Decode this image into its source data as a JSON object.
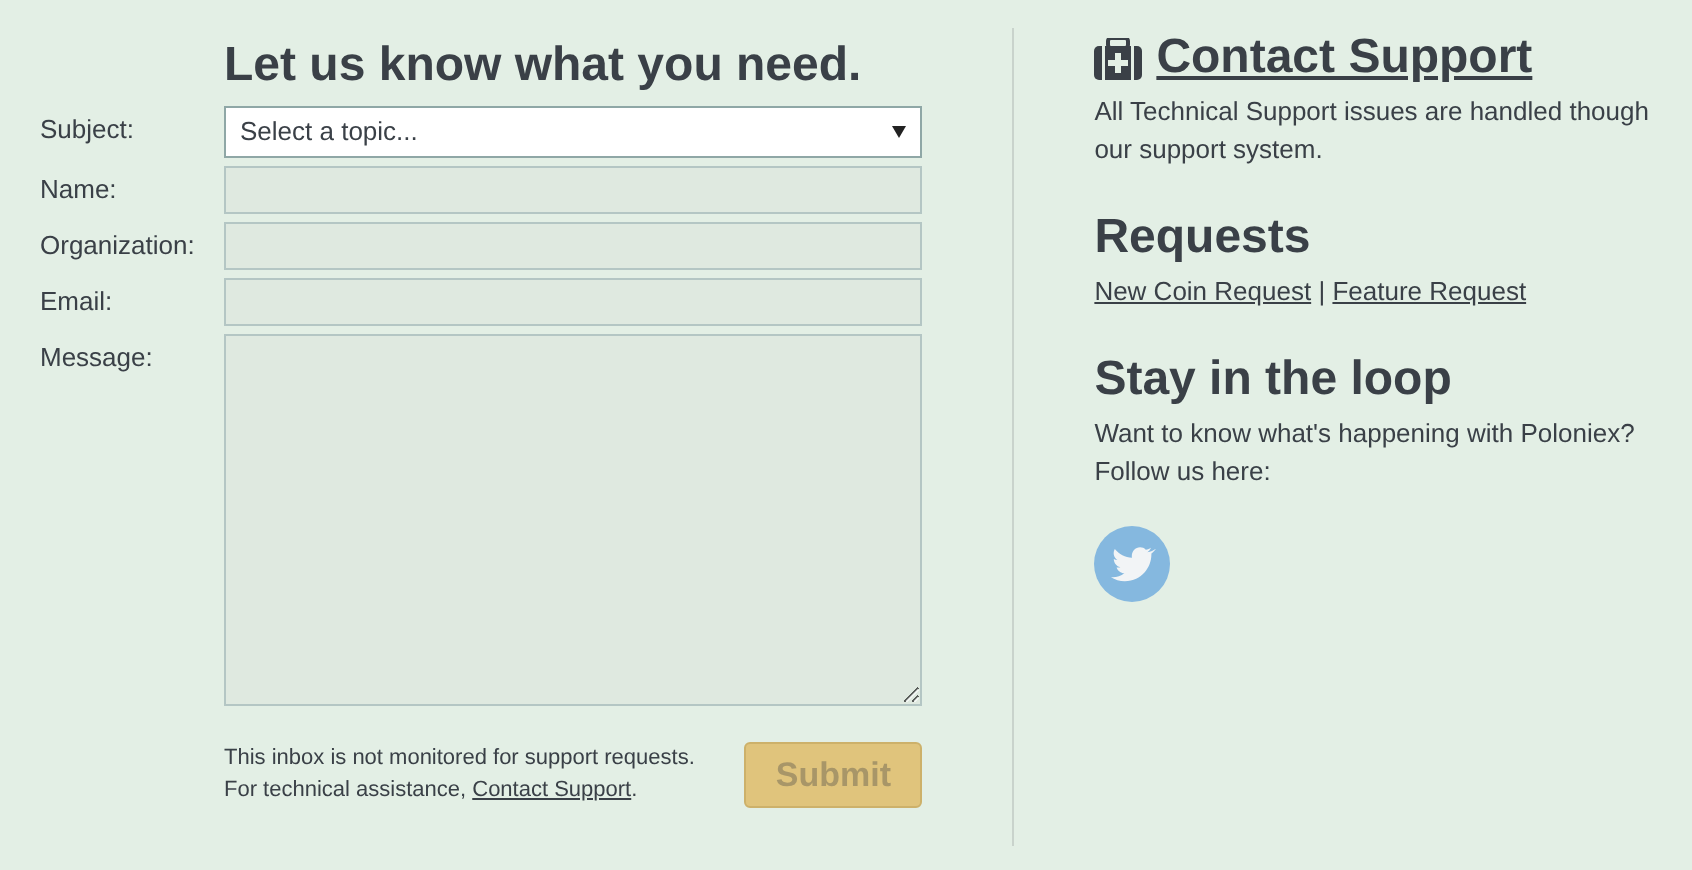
{
  "form": {
    "heading": "Let us know what you need.",
    "fields": [
      {
        "kind": "select",
        "label": "Subject:",
        "placeholder": "Select a topic..."
      },
      {
        "kind": "text",
        "label": "Name:"
      },
      {
        "kind": "text",
        "label": "Organization:"
      },
      {
        "kind": "text",
        "label": "Email:"
      },
      {
        "kind": "textarea",
        "label": "Message:"
      }
    ],
    "note": {
      "line_1": "This inbox is not monitored for support requests.",
      "line_2_prefix": "For technical assistance, ",
      "link": "Contact Support",
      "line_2_suffix": "."
    },
    "submit": {
      "label": "Submit",
      "disabled": true
    }
  },
  "sidebar": {
    "contact": {
      "title": "Contact Support",
      "text": "All Technical Support issues are handled though our support system."
    },
    "requests": {
      "title": "Requests",
      "links": [
        "New Coin Request",
        "Feature Request"
      ],
      "separator": "|"
    },
    "loop": {
      "title": "Stay in the loop",
      "text": "Want to know what's happening with Poloniex? Follow us here:"
    }
  }
}
